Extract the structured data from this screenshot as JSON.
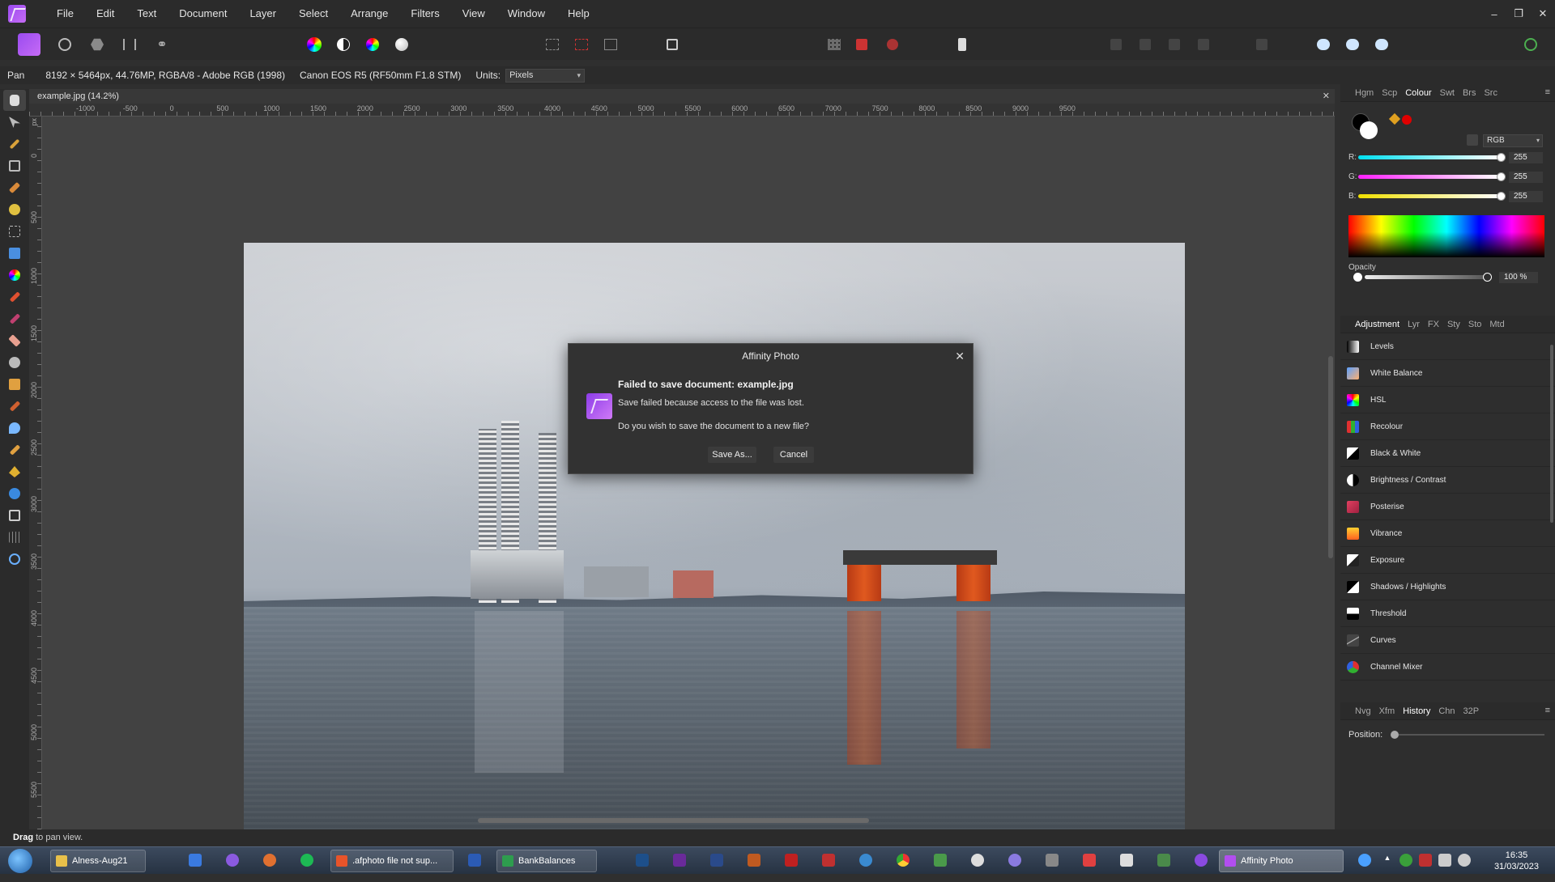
{
  "menu": {
    "items": [
      "File",
      "Edit",
      "Text",
      "Document",
      "Layer",
      "Select",
      "Arrange",
      "Filters",
      "View",
      "Window",
      "Help"
    ]
  },
  "context": {
    "tool": "Pan",
    "doc_info": "8192 × 5464px, 44.76MP, RGBA/8 - Adobe RGB (1998)",
    "camera": "Canon EOS R5 (RF50mm F1.8 STM)",
    "units_label": "Units:",
    "units_value": "Pixels"
  },
  "document": {
    "tab_title": "example.jpg (14.2%)",
    "ruler_h": [
      "-1000",
      "-500",
      "0",
      "500",
      "1000",
      "1500",
      "2000",
      "2500",
      "3000",
      "3500",
      "4000",
      "4500",
      "5000",
      "5500",
      "6000",
      "6500",
      "7000",
      "7500",
      "8000",
      "8500",
      "9000",
      "9500"
    ],
    "ruler_v": [
      "0",
      "500",
      "1000",
      "1500",
      "2000",
      "2500",
      "3000",
      "3500",
      "4000",
      "4500",
      "5000",
      "5500"
    ],
    "ruler_unit": "px"
  },
  "dialog": {
    "title": "Affinity Photo",
    "heading": "Failed to save document: example.jpg",
    "message1": "Save failed because access to the file was lost.",
    "message2": "Do you wish to save the document to a new file?",
    "save_as_label": "Save As...",
    "cancel_label": "Cancel"
  },
  "colour_panel": {
    "tabs": [
      "Hgm",
      "Scp",
      "Colour",
      "Swt",
      "Brs",
      "Src"
    ],
    "active_tab": "Colour",
    "model": "RGB",
    "channels": [
      {
        "label": "R:",
        "value": "255"
      },
      {
        "label": "G:",
        "value": "255"
      },
      {
        "label": "B:",
        "value": "255"
      }
    ],
    "opacity_label": "Opacity",
    "opacity_value": "100 %",
    "fg_color": "#000000",
    "bg_color": "#ffffff",
    "recent_color": "#e00000"
  },
  "adjust_panel": {
    "tabs": [
      "Adjustment",
      "Lyr",
      "FX",
      "Sty",
      "Sto",
      "Mtd"
    ],
    "active_tab": "Adjustment",
    "items": [
      {
        "label": "Levels",
        "icon": "levels-icon"
      },
      {
        "label": "White Balance",
        "icon": "white-balance-icon"
      },
      {
        "label": "HSL",
        "icon": "hsl-icon"
      },
      {
        "label": "Recolour",
        "icon": "recolour-icon"
      },
      {
        "label": "Black & White",
        "icon": "black-white-icon"
      },
      {
        "label": "Brightness / Contrast",
        "icon": "brightness-contrast-icon"
      },
      {
        "label": "Posterise",
        "icon": "posterise-icon"
      },
      {
        "label": "Vibrance",
        "icon": "vibrance-icon"
      },
      {
        "label": "Exposure",
        "icon": "exposure-icon"
      },
      {
        "label": "Shadows / Highlights",
        "icon": "shadows-highlights-icon"
      },
      {
        "label": "Threshold",
        "icon": "threshold-icon"
      },
      {
        "label": "Curves",
        "icon": "curves-icon"
      },
      {
        "label": "Channel Mixer",
        "icon": "channel-mixer-icon"
      }
    ]
  },
  "history_panel": {
    "tabs": [
      "Nvg",
      "Xfm",
      "History",
      "Chn",
      "32P"
    ],
    "active_tab": "History",
    "position_label": "Position:"
  },
  "status": {
    "bold": "Drag",
    "text": " to pan view."
  },
  "taskbar": {
    "buttons": [
      {
        "label": "Alness-Aug21",
        "color": "#e8c04a"
      },
      {
        "label": ".afphoto file not sup...",
        "color": "#e8542a"
      },
      {
        "label": "BankBalances",
        "color": "#2e9d4e"
      },
      {
        "label": "Affinity Photo",
        "color": "#b24ef0"
      }
    ],
    "time": "16:35",
    "date": "31/03/2023"
  }
}
